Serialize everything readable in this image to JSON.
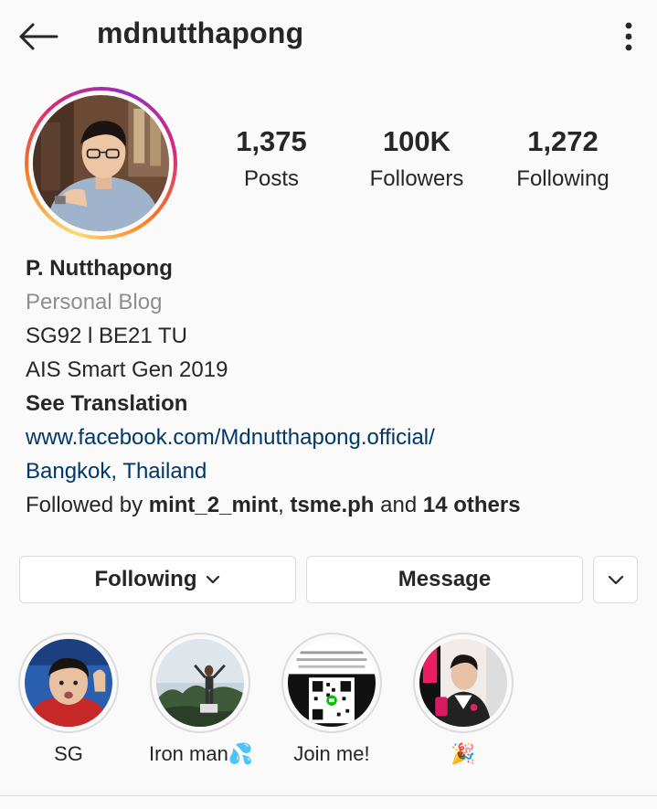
{
  "header": {
    "username": "mdnutthapong",
    "back_icon": "arrow-left-icon",
    "more_icon": "vertical-dots-icon"
  },
  "stats": [
    {
      "value": "1,375",
      "label": "Posts"
    },
    {
      "value": "100K",
      "label": "Followers"
    },
    {
      "value": "1,272",
      "label": "Following"
    }
  ],
  "bio": {
    "name": "P. Nutthapong",
    "category": "Personal Blog",
    "line1": "SG92 l BE21 TU",
    "line2": "AIS Smart Gen 2019",
    "see_translation": "See Translation",
    "website": "www.facebook.com/Mdnutthapong.official/",
    "location": "Bangkok, Thailand",
    "followed_by_prefix": "Followed by ",
    "follower1": "mint_2_mint",
    "separator": ", ",
    "follower2": "tsme.ph",
    "and_text": " and ",
    "others": "14 others"
  },
  "actions": {
    "following_label": "Following",
    "message_label": "Message"
  },
  "highlights": [
    {
      "label": "SG"
    },
    {
      "label": "Iron man💦"
    },
    {
      "label": "Join me!"
    },
    {
      "label": "🎉"
    }
  ],
  "colors": {
    "text": "#262626",
    "secondary": "#8e8e8e",
    "link": "#00376b",
    "border": "#dbdbdb",
    "background": "#fafafa"
  }
}
